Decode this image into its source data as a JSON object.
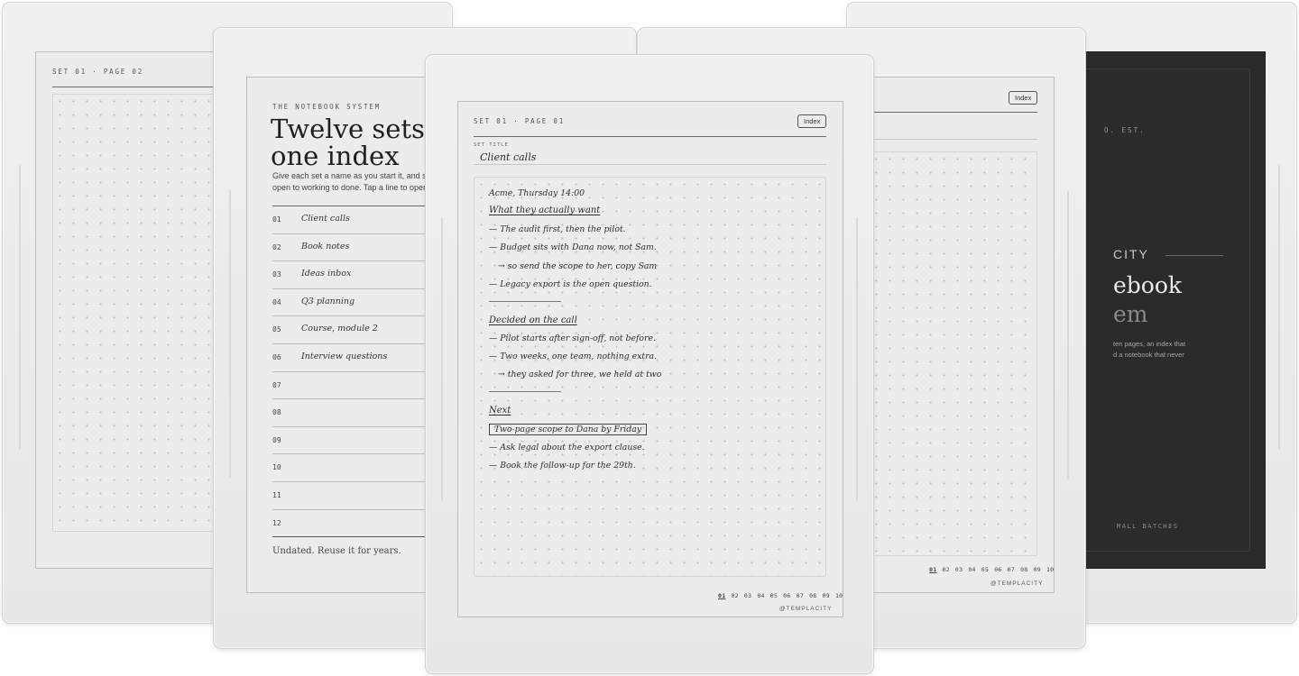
{
  "left_device": {
    "header": "SET 01 · PAGE 02"
  },
  "index_device": {
    "eyebrow": "THE NOTEBOOK SYSTEM",
    "title_line1": "Twelve sets,",
    "title_line2": "one index",
    "desc_line1": "Give each set a name as you start it, and sha",
    "desc_line2": "open to working to done. Tap a line to open e",
    "rows": [
      {
        "num": "01",
        "label": "Client calls"
      },
      {
        "num": "02",
        "label": "Book notes"
      },
      {
        "num": "03",
        "label": "Ideas inbox"
      },
      {
        "num": "04",
        "label": "Q3 planning"
      },
      {
        "num": "05",
        "label": "Course, module 2"
      },
      {
        "num": "06",
        "label": "Interview questions"
      },
      {
        "num": "07",
        "label": ""
      },
      {
        "num": "08",
        "label": ""
      },
      {
        "num": "09",
        "label": ""
      },
      {
        "num": "10",
        "label": ""
      },
      {
        "num": "11",
        "label": ""
      },
      {
        "num": "12",
        "label": ""
      }
    ],
    "footer": "Undated. Reuse it for years."
  },
  "center_device": {
    "header": "SET 01 · PAGE 01",
    "index_button": "Index",
    "set_title_label": "SET TITLE",
    "set_title": "Client calls",
    "notes": {
      "n1": "Acme, Thursday 14:00",
      "n2": "What they actually want",
      "n3": "— The audit first, then the pilot.",
      "n4": "— Budget sits with Dana now, not Sam.",
      "n5": "→ so send the scope to her, copy Sam",
      "n6": "— Legacy export is the open question.",
      "n7": "Decided on the call",
      "n8": "— Pilot starts after sign-off, not before.",
      "n9": "— Two weeks, one team, nothing extra.",
      "n10": "→ they asked for three, we held at two",
      "n11": "Next",
      "n12": "Two-page scope to Dana by Friday",
      "n13": "— Ask legal about the export clause.",
      "n14": "— Book the follow-up for the 29th."
    },
    "pages": [
      "01",
      "02",
      "03",
      "04",
      "05",
      "06",
      "07",
      "08",
      "09",
      "10"
    ],
    "brand": "@TEMPLACITY"
  },
  "right_device": {
    "index_button": "Index",
    "pages": [
      "01",
      "02",
      "03",
      "04",
      "05",
      "06",
      "07",
      "08",
      "09",
      "10"
    ],
    "brand": "@TEMPLACITY"
  },
  "cover_device": {
    "est": "O. EST.",
    "brand_word": "CITY",
    "title_line1": "ebook",
    "title_line2": "em",
    "desc_line1": "ten pages, an index that",
    "desc_line2": "d a notebook that never",
    "footer": "MALL BATCHES"
  }
}
